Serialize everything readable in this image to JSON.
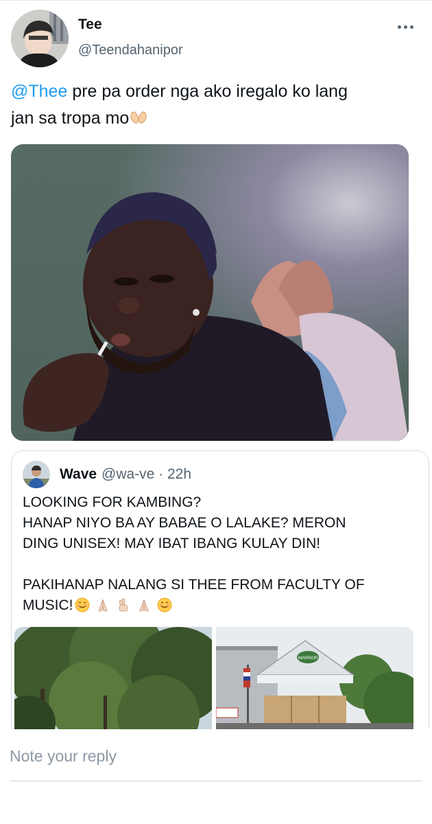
{
  "tweet": {
    "author_name": "Tee",
    "author_handle": "@Teendahanipor",
    "mention": "@Thee",
    "text_line1": " pre pa order nga ako iregalo ko lang",
    "text_line2": "jan sa tropa mo"
  },
  "quote": {
    "author_name": "Wave",
    "meta": "@wa-ve · 22h",
    "lines": [
      "LOOKING FOR KAMBING?",
      "HANAP NIYO BA AY BABAE O LALAKE? MERON",
      "DING UNISEX! MAY IBAT IBANG KULAY DIN!"
    ],
    "line4": "PAKIHANAP NALANG SI THEE FROM FACULTY OF",
    "line5": "MUSIC!",
    "tent_sign": "WARRIOR"
  },
  "reply": {
    "placeholder": "Note your reply"
  },
  "icons": {
    "more": "more-dots-icon",
    "hands": "heart-hands-icon",
    "pray": "praying-hands-icon",
    "fingers": "crossed-fingers-icon",
    "smile": "smiling-face-icon"
  }
}
